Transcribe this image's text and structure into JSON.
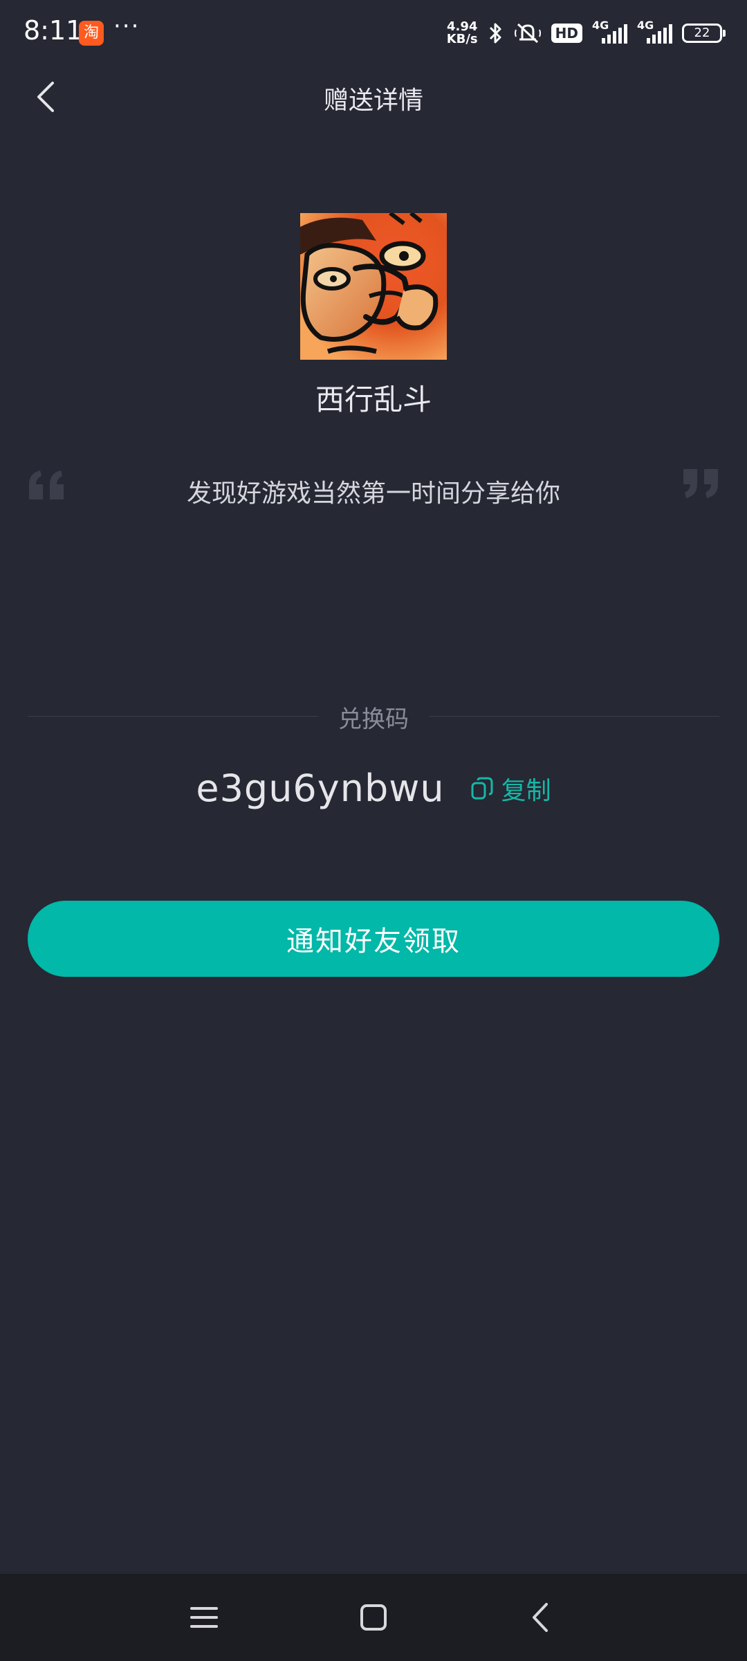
{
  "status_bar": {
    "time": "8:11",
    "app_badge": "淘",
    "more": "···",
    "net_speed_value": "4.94",
    "net_speed_unit": "KB/s",
    "hd_label": "HD",
    "signal1_label": "4G",
    "signal2_label": "4G",
    "battery_level": "22"
  },
  "header": {
    "title": "赠送详情"
  },
  "game": {
    "name": "西行乱斗"
  },
  "message": {
    "text": "发现好游戏当然第一时间分享给你"
  },
  "redeem": {
    "label": "兑换码",
    "code": "e3gu6ynbwu",
    "copy_label": "复制"
  },
  "actions": {
    "notify_label": "通知好友领取"
  },
  "colors": {
    "background": "#262834",
    "accent": "#02b8a8",
    "nav_bar": "#1c1d22"
  }
}
